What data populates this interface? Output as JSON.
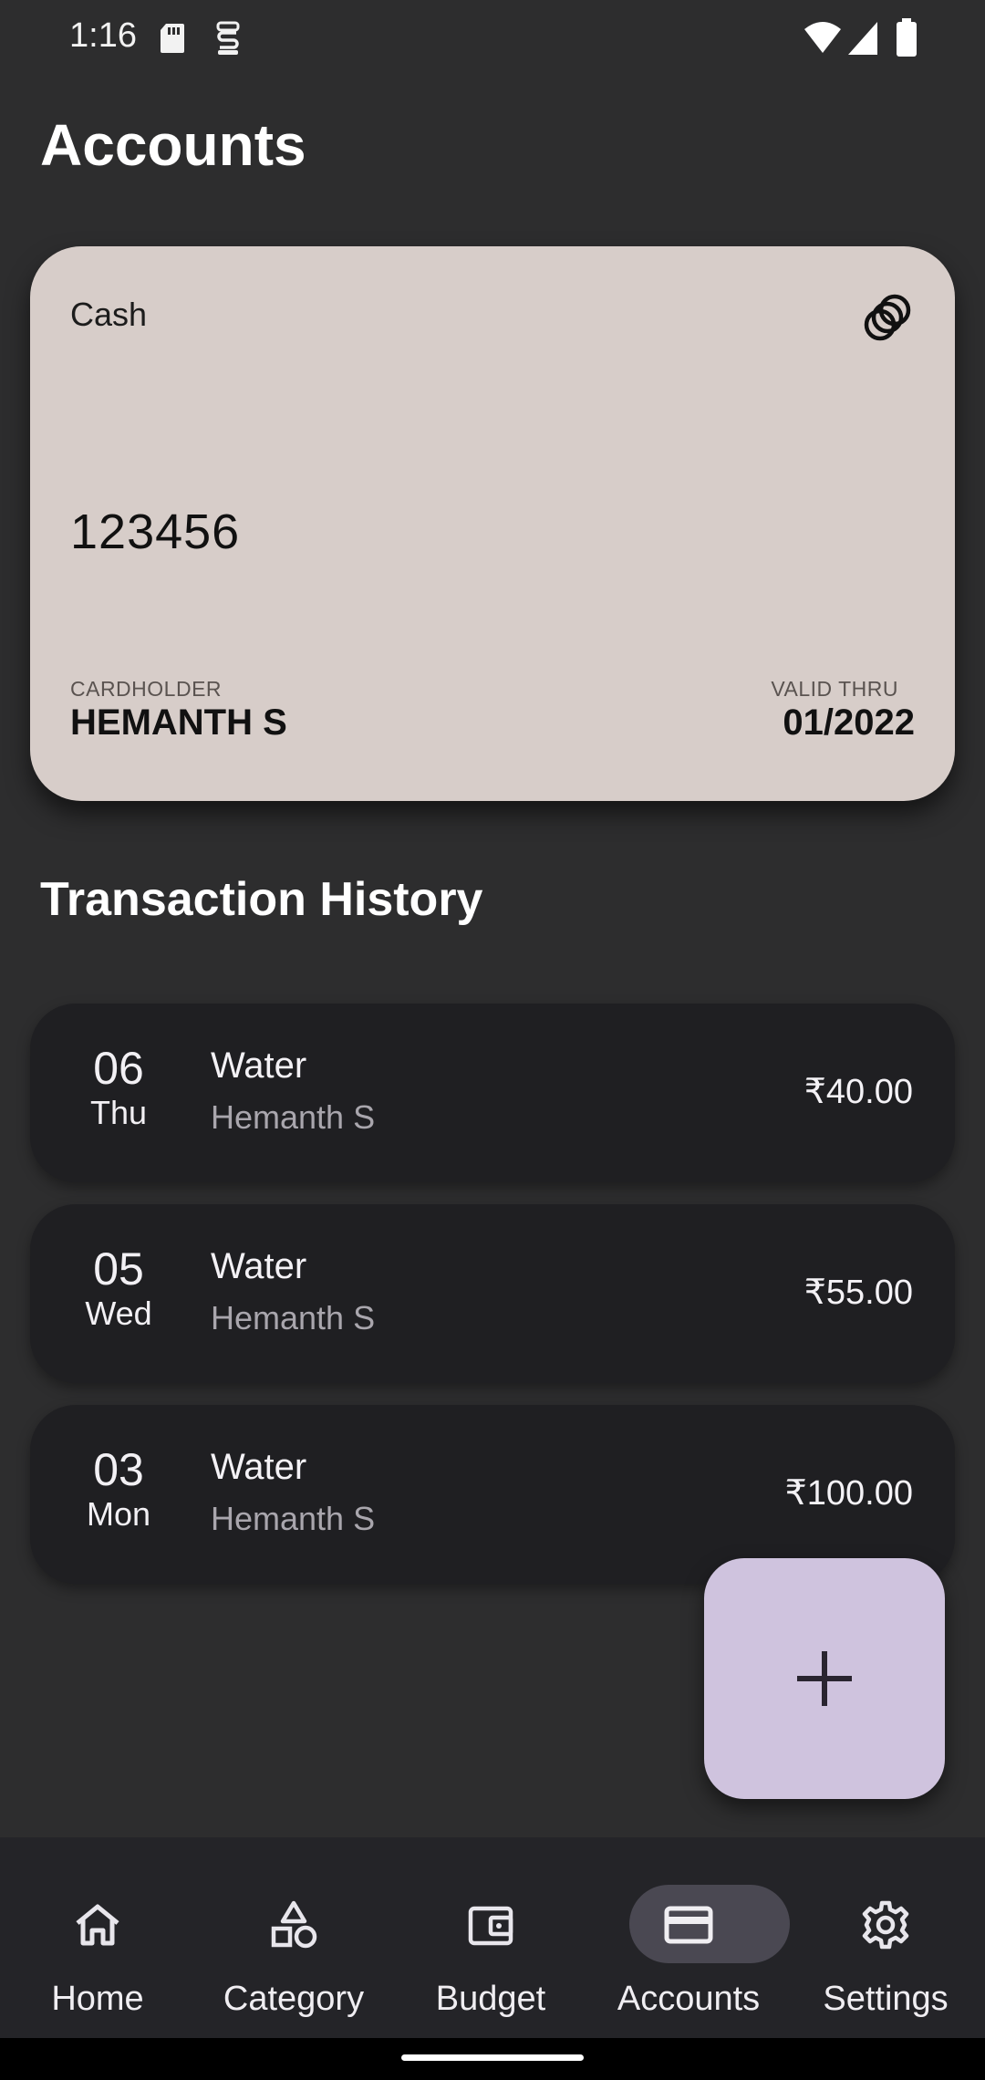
{
  "status_bar": {
    "time": "1:16"
  },
  "page": {
    "title": "Accounts"
  },
  "card": {
    "type": "Cash",
    "number": "123456",
    "cardholder_label": "CARDHOLDER",
    "cardholder_name": "HEMANTH S",
    "valid_label": "VALID THRU",
    "valid_value": "01/2022",
    "background_color": "#d7cdc9",
    "icon": "coins-icon"
  },
  "transactions": {
    "title": "Transaction History",
    "items": [
      {
        "day": "06",
        "weekday": "Thu",
        "category": "Water",
        "person": "Hemanth S",
        "amount": "₹40.00"
      },
      {
        "day": "05",
        "weekday": "Wed",
        "category": "Water",
        "person": "Hemanth S",
        "amount": "₹55.00"
      },
      {
        "day": "03",
        "weekday": "Mon",
        "category": "Water",
        "person": "Hemanth S",
        "amount": "₹100.00"
      }
    ]
  },
  "fab": {
    "icon": "plus-icon",
    "color": "#cfc3de"
  },
  "nav": {
    "items": [
      {
        "label": "Home",
        "icon": "home-icon"
      },
      {
        "label": "Category",
        "icon": "shapes-icon"
      },
      {
        "label": "Budget",
        "icon": "wallet-icon"
      },
      {
        "label": "Accounts",
        "icon": "credit-card-icon",
        "active": true
      },
      {
        "label": "Settings",
        "icon": "gear-icon"
      }
    ]
  }
}
